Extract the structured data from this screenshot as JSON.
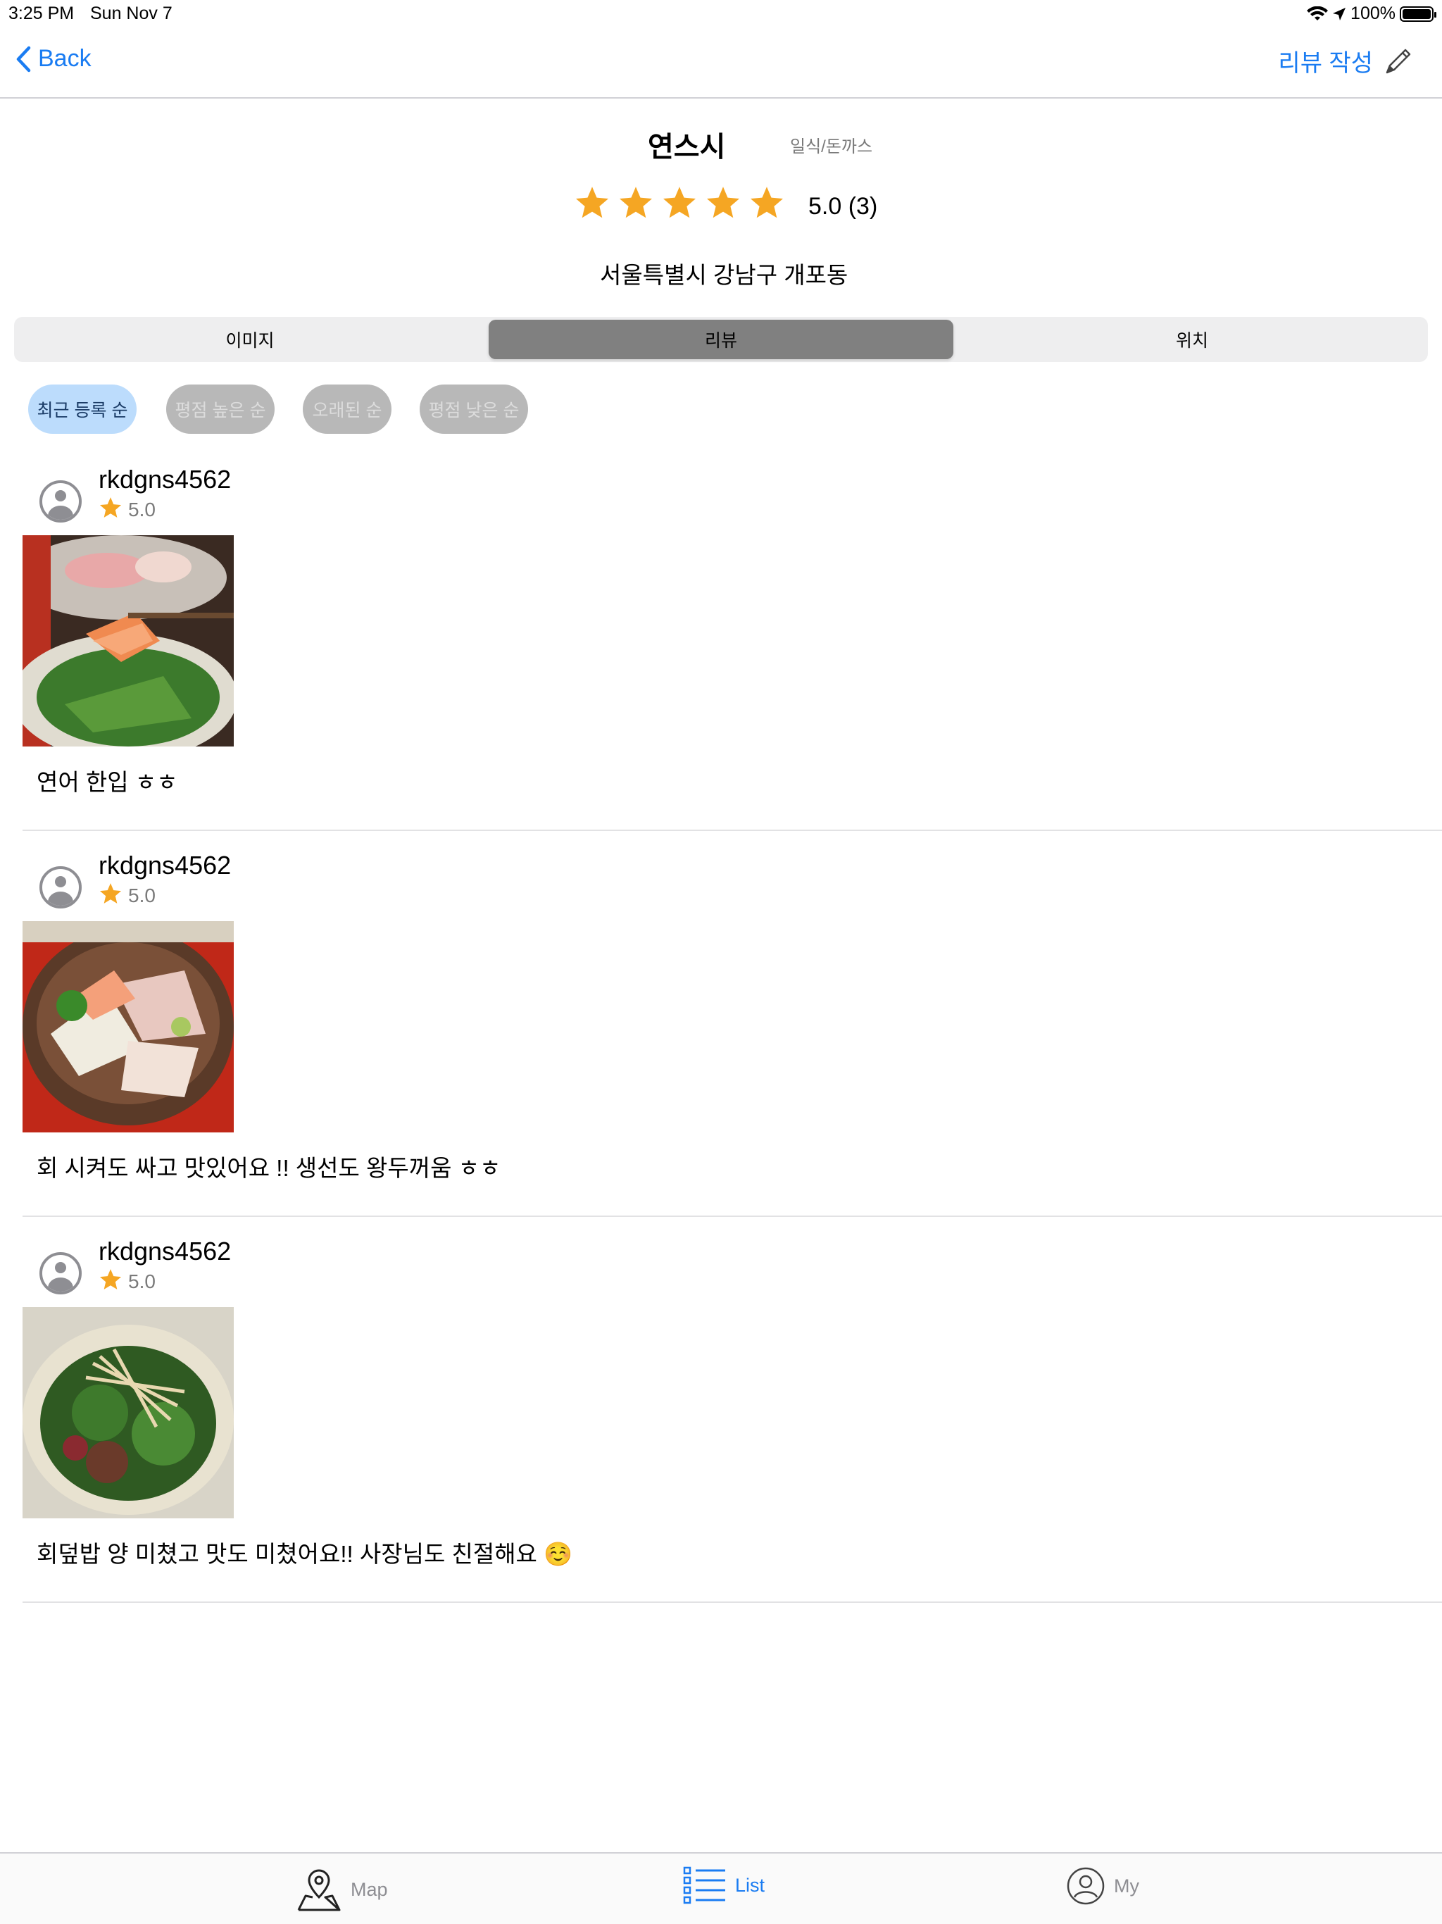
{
  "status_bar": {
    "time": "3:25 PM",
    "date": "Sun Nov 7",
    "battery": "100%"
  },
  "nav": {
    "back_label": "Back",
    "write_review_label": "리뷰 작성"
  },
  "store": {
    "name": "연스시",
    "category": "일식/돈까스",
    "rating_text": "5.0 (3)",
    "rating": 5.0,
    "address": "서울특별시 강남구 개포동"
  },
  "segments": {
    "items": [
      "이미지",
      "리뷰",
      "위치"
    ],
    "selected": "리뷰"
  },
  "filters": {
    "items": [
      "최근 등록 순",
      "평점 높은 순",
      "오래된 순",
      "평점 낮은 순"
    ],
    "selected": "최근 등록 순"
  },
  "reviews": [
    {
      "user": "rkdgns4562",
      "score": "5.0",
      "comment": "연어 한입 ㅎㅎ"
    },
    {
      "user": "rkdgns4562",
      "score": "5.0",
      "comment": "회 시켜도 싸고 맛있어요 !! 생선도 왕두꺼움 ㅎㅎ"
    },
    {
      "user": "rkdgns4562",
      "score": "5.0",
      "comment": "회덮밥 양 미쳤고 맛도 미쳤어요!! 사장님도 친절해요 ☺️"
    }
  ],
  "tab_bar": {
    "map": "Map",
    "list": "List",
    "my": "My",
    "selected": "List"
  },
  "colors": {
    "accent": "#1a7cf2",
    "star": "#f5a623",
    "active_segment": "#808080",
    "active_chip": "#bcdcfc"
  }
}
